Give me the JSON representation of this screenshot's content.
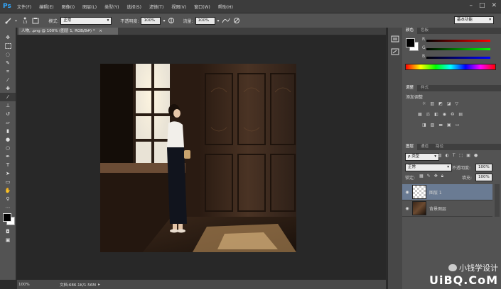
{
  "app": {
    "logo": "Ps"
  },
  "menu": [
    "文件(F)",
    "编辑(E)",
    "图像(I)",
    "图层(L)",
    "类型(Y)",
    "选择(S)",
    "滤镜(T)",
    "视图(V)",
    "窗口(W)",
    "帮助(H)"
  ],
  "window_controls": [
    "–",
    "□",
    "✕"
  ],
  "options": {
    "brush_size": "13",
    "mode_label": "模式:",
    "mode_value": "正常",
    "opacity_label": "不透明度:",
    "opacity_value": "100%",
    "flow_label": "流量:",
    "flow_value": "100%",
    "workspace": "基本功能"
  },
  "document_tab": {
    "title": "人物, .png @ 100% (图层 1, RGB/8#) *",
    "close": "×"
  },
  "status": {
    "zoom": "100%",
    "doc": "文档:686.1K/1.56M"
  },
  "color_panel": {
    "tabs": [
      "颜色",
      "色板"
    ],
    "channels": [
      "R",
      "G",
      "B"
    ]
  },
  "adjustments_panel": {
    "tabs": [
      "调整",
      "样式"
    ],
    "title": "添加调整"
  },
  "layers_panel": {
    "tabs": [
      "图层",
      "通道",
      "路径"
    ],
    "kind_label": "ρ 类型",
    "blend_mode": "正常",
    "opacity_label": "不透明度:",
    "opacity_value": "100%",
    "lock_label": "锁定:",
    "fill_label": "填充:",
    "fill_value": "100%",
    "layers": [
      {
        "name": "图层 1",
        "selected": true
      },
      {
        "name": "背景图层",
        "selected": false
      }
    ]
  },
  "watermark": {
    "chat": "小钱学设计",
    "site": "UiBQ.CoM"
  },
  "colors": {
    "accent": "#31a8ff",
    "selected_layer": "#6a7b93"
  }
}
